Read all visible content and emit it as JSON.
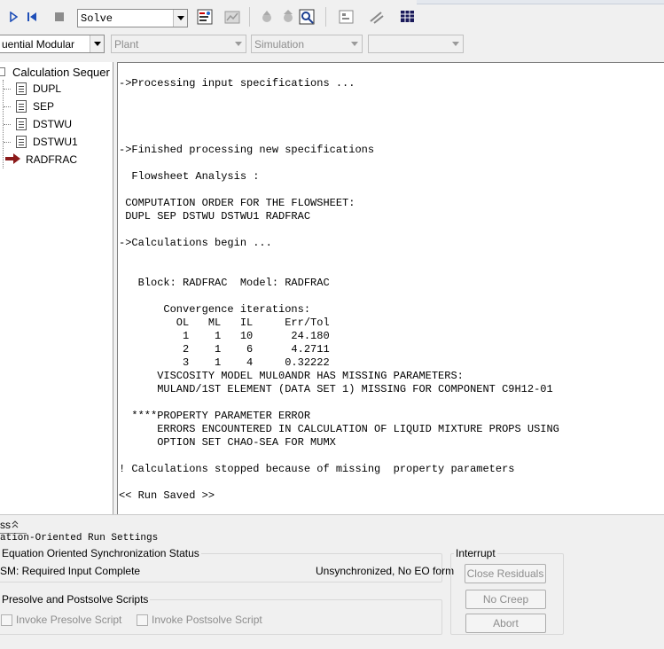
{
  "toolbar": {
    "run_mode": "Solve",
    "solver_mode": "uential Modular",
    "plant": "Plant",
    "simulation": "Simulation",
    "empty_combo": ""
  },
  "tree": {
    "root_label": "Calculation Sequer",
    "items": [
      {
        "label": "DUPL"
      },
      {
        "label": "SEP"
      },
      {
        "label": "DSTWU"
      },
      {
        "label": "DSTWU1"
      },
      {
        "label": "RADFRAC"
      }
    ]
  },
  "output": {
    "text": "->Processing input specifications ...\n\n\n\n\n->Finished processing new specifications\n\n  Flowsheet Analysis :\n\n COMPUTATION ORDER FOR THE FLOWSHEET:\n DUPL SEP DSTWU DSTWU1 RADFRAC\n\n->Calculations begin ...\n\n\n   Block: RADFRAC  Model: RADFRAC\n\n       Convergence iterations:\n         OL   ML   IL     Err/Tol\n          1    1   10      24.180\n          2    1    6      4.2711\n          3    1    4     0.32222\n      VISCOSITY MODEL MUL0ANDR HAS MISSING PARAMETERS:\n      MULAND/1ST ELEMENT (DATA SET 1) MISSING FOR COMPONENT C9H12-01\n\n  ****PROPERTY PARAMETER ERROR\n      ERRORS ENCOUNTERED IN CALCULATION OF LIQUID MIXTURE PROPS USING\n      OPTION SET CHAO-SEA FOR MUMX\n\n! Calculations stopped because of missing  property parameters\n\n<< Run Saved >>"
  },
  "bottom": {
    "tab_label": "ss",
    "panel_title": "ation-Oriented Run Settings",
    "eo_sync_title": "Equation Oriented Synchronization Status",
    "eo_status_left": "SM: Required Input Complete",
    "eo_status_right": "Unsynchronized, No EO form",
    "scripts_title": "Presolve and Postsolve Scripts",
    "presolve_label": "Invoke Presolve Script",
    "postsolve_label": "Invoke Postsolve Script",
    "interrupt_title": "Interrupt",
    "close_residuals": "Close Residuals",
    "no_creep": "No Creep",
    "abort": "Abort"
  },
  "colors": {
    "play_blue": "#1f4fb8",
    "radfrac_arrow": "#8b1a1a"
  }
}
